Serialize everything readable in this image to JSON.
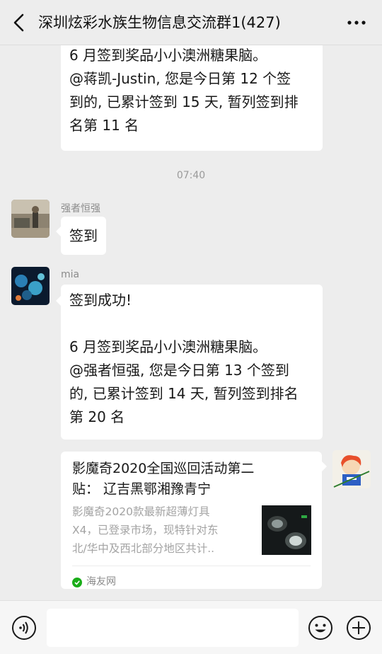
{
  "header": {
    "title": "深圳炫彩水族生物信息交流群1(427)",
    "back_icon": "chevron-left-icon",
    "more_icon": "ellipsis-icon"
  },
  "messages": [
    {
      "lines": [
        "6 月签到奖品小小澳洲糖果脑。",
        "@蒋凯-Justin, 您是今日第 12 个签",
        "到的, 已累计签到 15 天, 暂列签到排",
        "名第 11 名"
      ]
    },
    {
      "timestamp": "07:40"
    },
    {
      "sender": "强者恒强",
      "text": "签到"
    },
    {
      "sender": "mia",
      "lines": [
        "签到成功!",
        "",
        "6 月签到奖品小小澳洲糖果脑。",
        "@强者恒强, 您是今日第 13 个签到",
        "的, 已累计签到 14 天, 暂列签到排名",
        "第 20 名"
      ]
    },
    {
      "card": {
        "title_lines": [
          "影魔奇2020全国巡回活动第二",
          "贴： 辽吉黑鄂湘豫青宁"
        ],
        "desc_lines": [
          "影魔奇2020款最新超薄灯具",
          "X4，已登录市场，现特针对东",
          "北/华中及西北部分地区共计.."
        ],
        "source": "海友网"
      }
    }
  ],
  "input": {
    "value": "",
    "placeholder": ""
  },
  "colors": {
    "background": "#ededed",
    "bubble": "#ffffff",
    "source_icon": "#1aad19"
  }
}
